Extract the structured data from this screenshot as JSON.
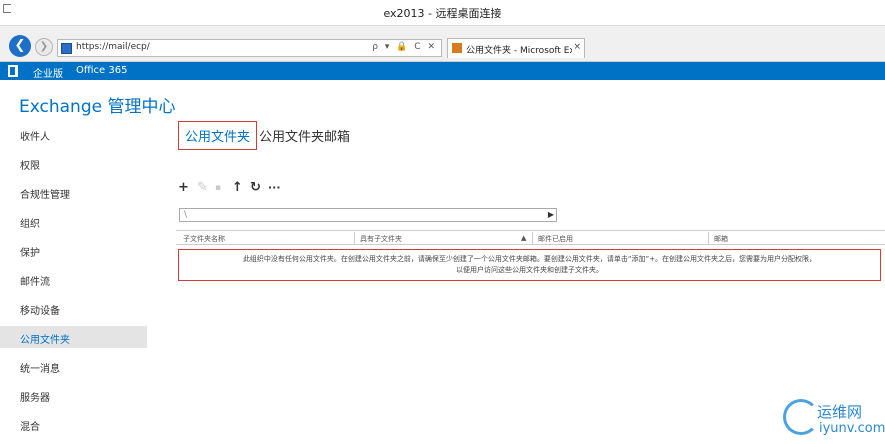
{
  "window": {
    "title": "ex2013 - 远程桌面连接"
  },
  "browser": {
    "url": "https://mail/ecp/",
    "address_icons": "ρ ▾ 🔒 C ✕",
    "tab_label": "公用文件夹 - Microsoft Ex...",
    "tab_close": "×"
  },
  "suitebar": {
    "enterprise": "企业版",
    "office365": "Office 365"
  },
  "app": {
    "title": "Exchange 管理中心"
  },
  "sidebar": {
    "items": [
      {
        "label": "收件人"
      },
      {
        "label": "权限"
      },
      {
        "label": "合规性管理"
      },
      {
        "label": "组织"
      },
      {
        "label": "保护"
      },
      {
        "label": "邮件流"
      },
      {
        "label": "移动设备"
      },
      {
        "label": "公用文件夹"
      },
      {
        "label": "统一消息"
      },
      {
        "label": "服务器"
      },
      {
        "label": "混合"
      }
    ],
    "active_index": 7
  },
  "main": {
    "tabs": [
      {
        "label": "公用文件夹"
      },
      {
        "label": "公用文件夹邮箱"
      }
    ],
    "toolbar": {
      "add": "+",
      "edit": "✎",
      "delete": "▪",
      "up": "↑",
      "refresh": "↻",
      "more": "···"
    },
    "search": {
      "value": "\\",
      "go": "▶"
    },
    "columns": [
      "子文件夹名称",
      "具有子文件夹",
      "邮件已启用",
      "邮箱"
    ],
    "sort_indicator": "▲",
    "empty_message": [
      "此组织中没有任何公用文件夹。在创建公用文件夹之前，请确保至少创建了一个公用文件夹邮箱。要创建公用文件夹，请单击“添加”+。在创建公用文件夹之后，您需要为用户分配权限，",
      "以便用户访问这些公用文件夹和创建子文件夹。"
    ]
  },
  "watermark": {
    "cn": "运维网",
    "en": "iyunv.com"
  },
  "colors": {
    "accent": "#0072c6",
    "highlight_box": "#d23b3b",
    "active_nav_bg": "#e4e4e4"
  }
}
